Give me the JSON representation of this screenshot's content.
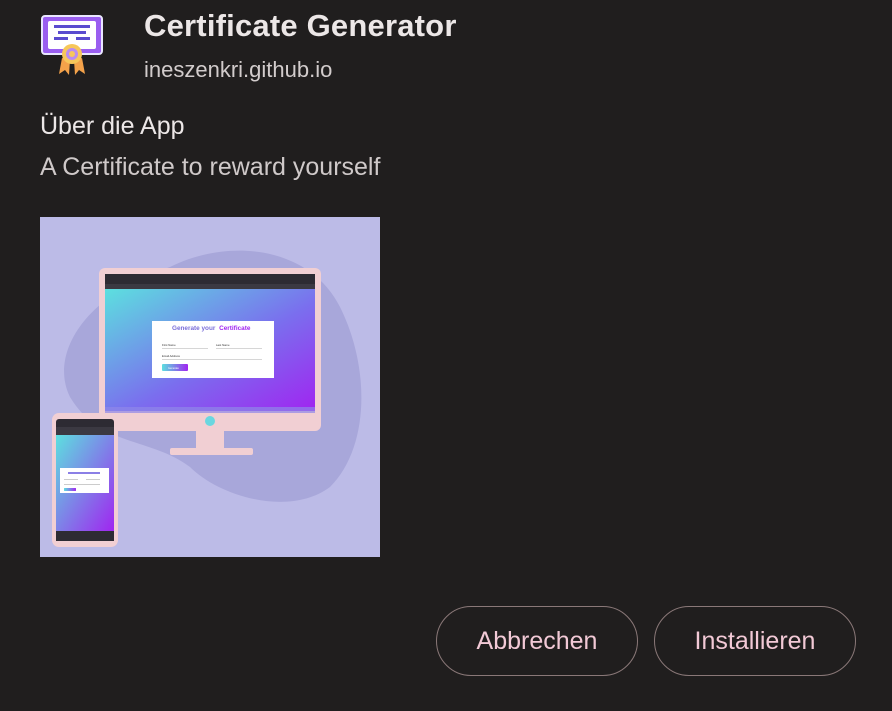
{
  "app": {
    "name": "Certificate Generator",
    "origin": "ineszenkri.github.io",
    "icon": "certificate-ribbon-icon"
  },
  "about": {
    "heading": "Über die App",
    "description": "A Certificate to reward yourself"
  },
  "screenshot": {
    "headline_part1": "Generate your",
    "headline_part2": "Certificate",
    "field_first_name": "First Name",
    "field_last_name": "Last Name",
    "field_email": "Email Address",
    "submit_label": "Generate"
  },
  "actions": {
    "cancel_label": "Abbrechen",
    "install_label": "Installieren"
  },
  "colors": {
    "background": "#201e1e",
    "button_text": "#f2c9d6",
    "button_border": "#8a7878",
    "screenshot_bg": "#bcbbe7",
    "gradient_start": "#5ce0df",
    "gradient_end": "#a025f0"
  }
}
